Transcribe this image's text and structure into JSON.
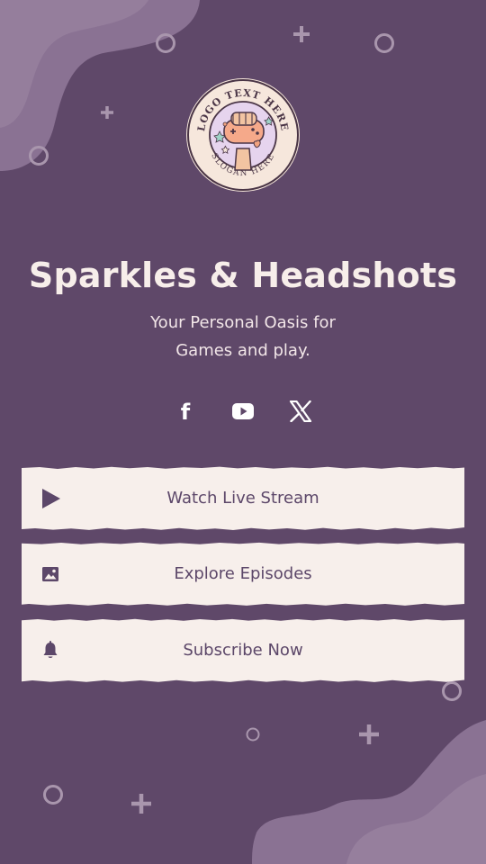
{
  "profile": {
    "title": "Sparkles & Headshots",
    "subtitle_line1": "Your Personal Oasis for",
    "subtitle_line2": "Games and play.",
    "logo": {
      "text_top": "LOGO TEXT HERE",
      "text_bottom": "SLOGAN HERE"
    }
  },
  "social": [
    {
      "icon": "facebook-icon",
      "glyph": "f"
    },
    {
      "icon": "youtube-icon"
    },
    {
      "icon": "x-twitter-icon"
    }
  ],
  "links": [
    {
      "label": "Watch Live Stream",
      "icon": "play-icon"
    },
    {
      "label": "Explore Episodes",
      "icon": "image-icon"
    },
    {
      "label": "Subscribe Now",
      "icon": "bell-icon"
    }
  ],
  "colors": {
    "background": "#5f4869",
    "blob": "#8a7293",
    "title": "#f7eeea",
    "button_paper": "#f7efeb",
    "button_text": "#5c4769",
    "decoration": "#a996ad"
  }
}
